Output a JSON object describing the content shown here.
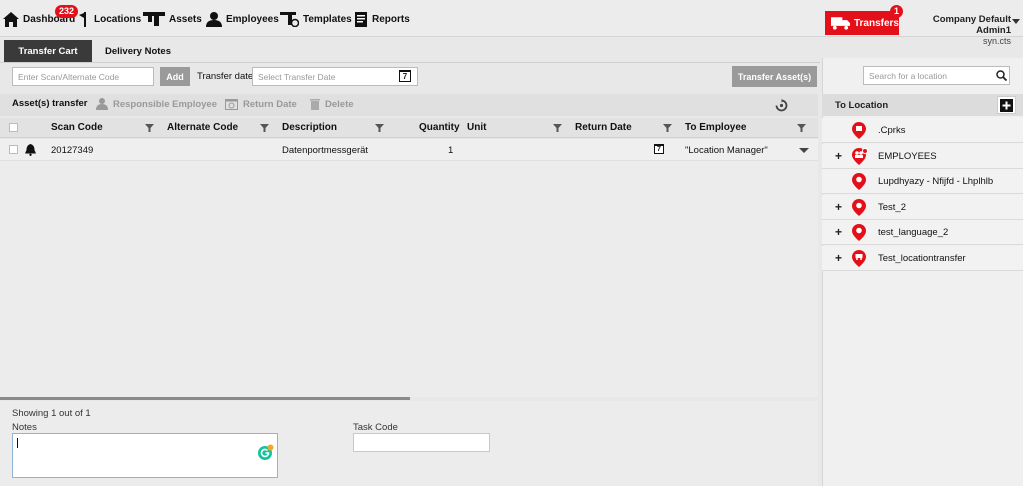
{
  "nav": {
    "dashboard": "Dashboard",
    "dashboard_badge": "232",
    "locations": "Locations",
    "assets": "Assets",
    "employees": "Employees",
    "templates": "Templates",
    "reports": "Reports",
    "transfers": "Transfers",
    "transfers_badge": "1",
    "user_name": "Company Default Admin1",
    "user_sub": "syn.cts"
  },
  "tabs": {
    "cart": "Transfer Cart",
    "notes": "Delivery Notes"
  },
  "toolbar": {
    "scan_placeholder": "Enter Scan/Alternate Code",
    "add_label": "Add",
    "transfer_date_label": "Transfer date",
    "transfer_date_placeholder": "Select Transfer Date",
    "calendar_day": "7",
    "transfer_assets_label": "Transfer Asset(s)"
  },
  "actions": {
    "title": "Asset(s) transfer",
    "responsible_employee": "Responsible Employee",
    "return_date": "Return Date",
    "delete": "Delete"
  },
  "table": {
    "columns": [
      "Scan Code",
      "Alternate Code",
      "Description",
      "Quantity",
      "Unit",
      "Return Date",
      "To Employee"
    ],
    "rows": [
      {
        "scan_code": "20127349",
        "alternate_code": "",
        "description": "Datenportmessgerät",
        "quantity": "1",
        "unit": "",
        "return_date_icon": "7",
        "to_employee": "\"Location Manager\""
      }
    ]
  },
  "footer": {
    "showing": "Showing 1 out of 1",
    "notes_label": "Notes",
    "task_code_label": "Task Code",
    "notes_value": "",
    "task_code_value": ""
  },
  "locations": {
    "search_placeholder": "Search for a location",
    "header": "To Location",
    "items": [
      {
        "label": ".Cprks",
        "expandable": false,
        "pin": "building"
      },
      {
        "label": "EMPLOYEES",
        "expandable": true,
        "pin": "people"
      },
      {
        "label": "Lupdhyazy - Nfijfd - Lhplhlb",
        "expandable": false,
        "pin": "plain"
      },
      {
        "label": "Test_2",
        "expandable": true,
        "pin": "plain"
      },
      {
        "label": "test_language_2",
        "expandable": true,
        "pin": "plain"
      },
      {
        "label": "Test_locationtransfer",
        "expandable": true,
        "pin": "vehicle"
      }
    ]
  },
  "colors": {
    "accent": "#e3101a",
    "tab_active": "#3a3a3a",
    "button_grey": "#9a9a9a"
  }
}
